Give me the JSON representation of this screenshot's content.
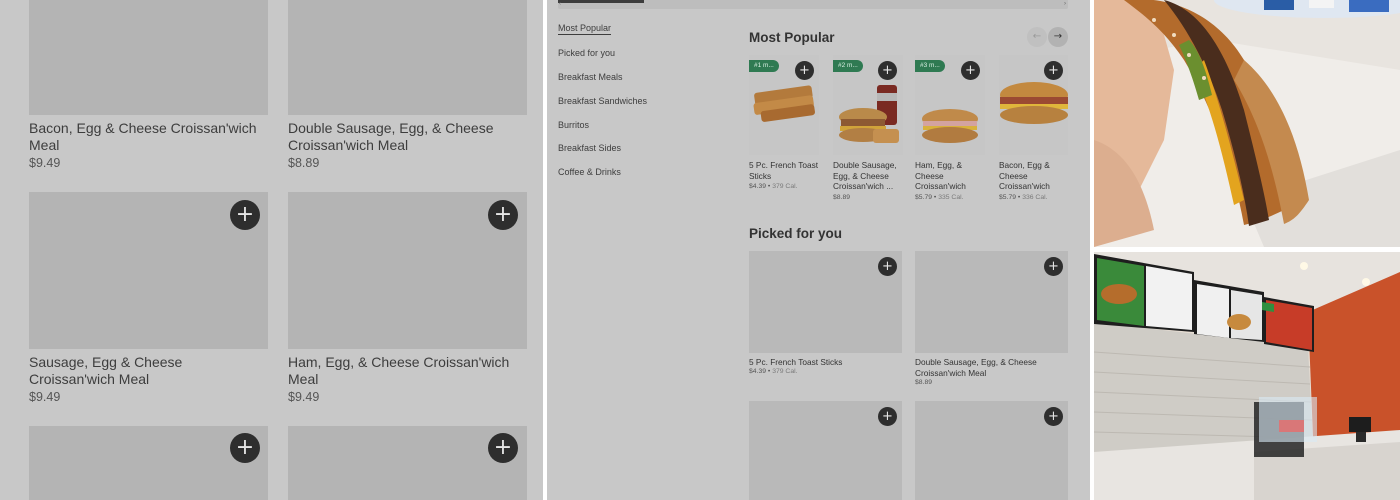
{
  "left_panel": {
    "items": [
      {
        "name": "Bacon, Egg & Cheese Croissan'wich Meal",
        "price": "$9.49"
      },
      {
        "name": "Double Sausage, Egg, & Cheese Croissan'wich Meal",
        "price": "$8.89"
      },
      {
        "name": "Sausage, Egg & Cheese Croissan'wich Meal",
        "price": "$9.49"
      },
      {
        "name": "Ham, Egg, & Cheese Croissan'wich Meal",
        "price": "$9.49"
      },
      {
        "name": "",
        "price": ""
      },
      {
        "name": "",
        "price": ""
      }
    ],
    "add_symbol": "+"
  },
  "middle_panel": {
    "categories": [
      "Most Popular",
      "Picked for you",
      "Breakfast Meals",
      "Breakfast Sandwiches",
      "Burritos",
      "Breakfast Sides",
      "Coffee & Drinks"
    ],
    "active_category": "Most Popular",
    "nav": {
      "prev": "←",
      "next": "→"
    },
    "scroll": {
      "left": "‹",
      "right": "›"
    },
    "most_popular": {
      "title": "Most Popular",
      "items": [
        {
          "badge": "#1 m...",
          "name": "5 Pc. French Toast Sticks",
          "price": "$4.39",
          "calories": "379 Cal."
        },
        {
          "badge": "#2 m...",
          "name": "Double Sausage, Egg, & Cheese Croissan'wich ...",
          "price": "$8.89",
          "calories": ""
        },
        {
          "badge": "#3 m...",
          "name": "Ham, Egg, & Cheese Croissan'wich",
          "price": "$5.79",
          "calories": "335 Cal."
        },
        {
          "badge": "",
          "name": "Bacon, Egg & Cheese Croissan'wich",
          "price": "$5.79",
          "calories": "336 Cal."
        }
      ]
    },
    "picked_for_you": {
      "title": "Picked for you",
      "items": [
        {
          "name": "5 Pc. French Toast Sticks",
          "price": "$4.39",
          "calories": "379 Cal."
        },
        {
          "name": "Double Sausage, Egg, & Cheese Croissan'wich Meal",
          "price": "$8.89",
          "calories": ""
        },
        {
          "name": "",
          "price": "",
          "calories": ""
        },
        {
          "name": "",
          "price": "",
          "calories": ""
        }
      ]
    },
    "add_symbol": "+",
    "meta_separator": " • "
  },
  "colors": {
    "overlay_gray": "#c8c8c8",
    "placeholder_gray": "#b4b4b4",
    "add_button": "#2e2e2e",
    "badge_green": "#2f7a52"
  },
  "photos": {
    "top": "Close-up of a bitten sausage croissant sandwich held in hand",
    "bottom": "Restaurant counter with digital menu boards above and orange accent wall"
  }
}
